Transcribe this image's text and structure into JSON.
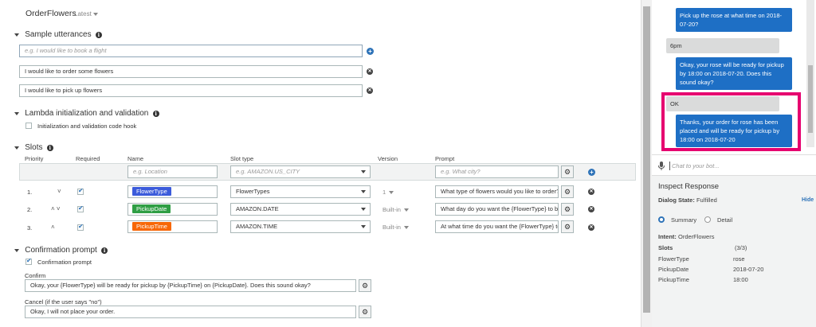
{
  "header": {
    "title": "OrderFlowers",
    "version": "Latest"
  },
  "utterances": {
    "heading": "Sample utterances",
    "placeholder": "e.g. I would like to book a flight",
    "items": [
      "I would like to order some flowers",
      "I would like to pick up flowers"
    ]
  },
  "lambda": {
    "heading": "Lambda initialization and validation",
    "hook_label": "Initialization and validation code hook"
  },
  "slots": {
    "heading": "Slots",
    "columns": {
      "priority": "Priority",
      "required": "Required",
      "name": "Name",
      "slot_type": "Slot type",
      "version": "Version",
      "prompt": "Prompt"
    },
    "new_row": {
      "name_placeholder": "e.g. Location",
      "type_placeholder": "e.g. AMAZON.US_CITY",
      "prompt_placeholder": "e.g. What city?"
    },
    "rows": [
      {
        "priority": "1.",
        "chevrons": "˅",
        "name": "FlowerType",
        "color": "#3b5bdb",
        "type": "FlowerTypes",
        "version": "1",
        "prompt": "What type of flowers would you like to order?"
      },
      {
        "priority": "2.",
        "chevrons": "˄ ˅",
        "name": "PickupDate",
        "color": "#2f9e44",
        "type": "AMAZON.DATE",
        "version": "Built-in",
        "prompt": "What day do you want the {FlowerType} to be"
      },
      {
        "priority": "3.",
        "chevrons": "˄",
        "name": "PickupTime",
        "color": "#f76707",
        "type": "AMAZON.TIME",
        "version": "Built-in",
        "prompt": "At what time do you want the {FlowerType} to"
      }
    ]
  },
  "confirmation": {
    "heading": "Confirmation prompt",
    "checkbox_label": "Confirmation prompt",
    "confirm_label": "Confirm",
    "confirm_value": "Okay, your {FlowerType} will be ready for pickup by {PickupTime} on {PickupDate}.  Does this sound okay?",
    "cancel_label": "Cancel (if the user says \"no\")",
    "cancel_value": "Okay, I will not place your order."
  },
  "chat": {
    "messages": [
      {
        "from": "user",
        "text": "Pick up the rose at what time on 2018-07-20?"
      },
      {
        "from": "bot",
        "text": "6pm"
      },
      {
        "from": "user",
        "text": "Okay, your rose will be ready for pickup by 18:00 on 2018-07-20. Does this sound okay?"
      },
      {
        "from": "bot",
        "text": "OK"
      },
      {
        "from": "user",
        "text": "Thanks, your order for rose has been placed and will be ready for pickup by 18:00 on 2018-07-20"
      }
    ],
    "input_placeholder": "Chat to your bot..."
  },
  "inspect": {
    "title": "Inspect Response",
    "dialog_state_label": "Dialog State:",
    "dialog_state": "Fulfilled",
    "hide": "Hide",
    "summary_label": "Summary",
    "detail_label": "Detail",
    "intent_label": "Intent:",
    "intent": "OrderFlowers",
    "slots_label": "Slots",
    "slots_count": "(3/3)",
    "slot_values": [
      {
        "name": "FlowerType",
        "value": "rose"
      },
      {
        "name": "PickupDate",
        "value": "2018-07-20"
      },
      {
        "name": "PickupTime",
        "value": "18:00"
      }
    ]
  },
  "colors": {
    "accent": "#2e73b8",
    "highlight": "#e6006f",
    "user_bubble": "#1e6fc5"
  }
}
